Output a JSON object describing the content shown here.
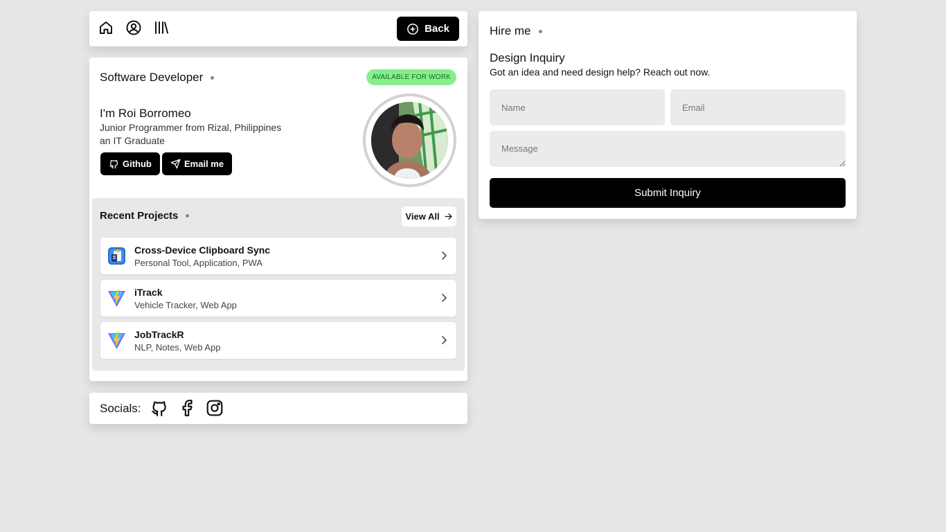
{
  "nav": {
    "icons": [
      "home-icon",
      "user-circle-icon",
      "library-icon"
    ],
    "back_label": "Back",
    "back_icon": "plus-circle-icon"
  },
  "profile": {
    "role": "Software Developer",
    "status_badge": "AVAILABLE FOR WORK",
    "greeting": "I'm Roi Borromeo",
    "line1": "Junior Programmer from Rizal, Philippines",
    "line2": "an IT Graduate",
    "github_label": "Github",
    "email_label": "Email me"
  },
  "projects": {
    "title": "Recent Projects",
    "view_all_label": "View All",
    "items": [
      {
        "name": "Cross-Device Clipboard Sync",
        "tags": "Personal Tool, Application, PWA",
        "icon": "clipboard-app-icon"
      },
      {
        "name": "iTrack",
        "tags": "Vehicle Tracker, Web App",
        "icon": "vite-icon"
      },
      {
        "name": "JobTrackR",
        "tags": "NLP, Notes, Web App",
        "icon": "vite-icon"
      }
    ]
  },
  "socials": {
    "label": "Socials:",
    "icons": [
      "github-icon",
      "facebook-icon",
      "instagram-icon"
    ]
  },
  "hire": {
    "title": "Hire me",
    "inquiry_title": "Design Inquiry",
    "inquiry_sub": "Got an idea and need design help? Reach out now.",
    "name_placeholder": "Name",
    "email_placeholder": "Email",
    "message_placeholder": "Message",
    "submit_label": "Submit Inquiry"
  },
  "colors": {
    "background": "#e6e6e6",
    "badge_bg": "#86ef8c",
    "badge_text": "#136b1e",
    "button": "#000000"
  }
}
